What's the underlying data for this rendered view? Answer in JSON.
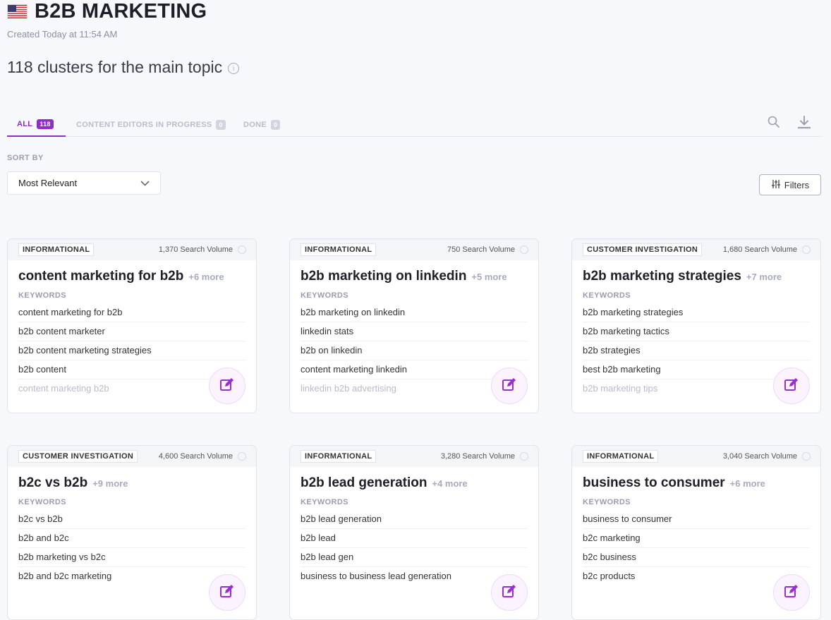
{
  "header": {
    "title": "B2B MARKETING",
    "created": "Created Today at 11:54 AM",
    "flag_icon": "us-flag-icon"
  },
  "summary": {
    "text": "118 clusters for the main topic",
    "icon": "info-icon"
  },
  "tabs": [
    {
      "label": "ALL",
      "count": "118"
    },
    {
      "label": "CONTENT EDITORS IN PROGRESS",
      "count": "0"
    },
    {
      "label": "DONE",
      "count": "0"
    }
  ],
  "toolbar": {
    "search_icon": "search-icon",
    "download_icon": "download-icon"
  },
  "sort": {
    "label": "SORT BY",
    "value": "Most Relevant"
  },
  "filters": {
    "label": "Filters",
    "icon": "sliders-icon"
  },
  "colors": {
    "accent": "#8c2ec7",
    "background": "#f7f8fc"
  },
  "cards": [
    {
      "intent": "INFORMATIONAL",
      "volume": "1,370 Search Volume",
      "title": "content marketing for b2b",
      "more": "+6 more",
      "keywords_label": "KEYWORDS",
      "keywords": [
        "content marketing for b2b",
        "b2b content marketer",
        "b2b content marketing strategies",
        "b2b content",
        "content marketing b2b"
      ]
    },
    {
      "intent": "INFORMATIONAL",
      "volume": "750 Search Volume",
      "title": "b2b marketing on linkedin",
      "more": "+5 more",
      "keywords_label": "KEYWORDS",
      "keywords": [
        "b2b marketing on linkedin",
        "linkedin stats",
        "b2b on linkedin",
        "content marketing linkedin",
        "linkedin b2b advertising"
      ]
    },
    {
      "intent": "CUSTOMER INVESTIGATION",
      "volume": "1,680 Search Volume",
      "title": "b2b marketing strategies",
      "more": "+7 more",
      "keywords_label": "KEYWORDS",
      "keywords": [
        "b2b marketing strategies",
        "b2b marketing tactics",
        "b2b strategies",
        "best b2b marketing",
        "b2b marketing tips"
      ]
    },
    {
      "intent": "CUSTOMER INVESTIGATION",
      "volume": "4,600 Search Volume",
      "title": "b2c vs b2b",
      "more": "+9 more",
      "keywords_label": "KEYWORDS",
      "keywords": [
        "b2c vs b2b",
        "b2b and b2c",
        "b2b marketing vs b2c",
        "b2b and b2c marketing",
        ""
      ]
    },
    {
      "intent": "INFORMATIONAL",
      "volume": "3,280 Search Volume",
      "title": "b2b lead generation",
      "more": "+4 more",
      "keywords_label": "KEYWORDS",
      "keywords": [
        "b2b lead generation",
        "b2b lead",
        "b2b lead gen",
        "business to business lead generation",
        ""
      ]
    },
    {
      "intent": "INFORMATIONAL",
      "volume": "3,040 Search Volume",
      "title": "business to consumer",
      "more": "+6 more",
      "keywords_label": "KEYWORDS",
      "keywords": [
        "business to consumer",
        "b2c marketing",
        "b2c business",
        "b2c products",
        ""
      ]
    }
  ]
}
